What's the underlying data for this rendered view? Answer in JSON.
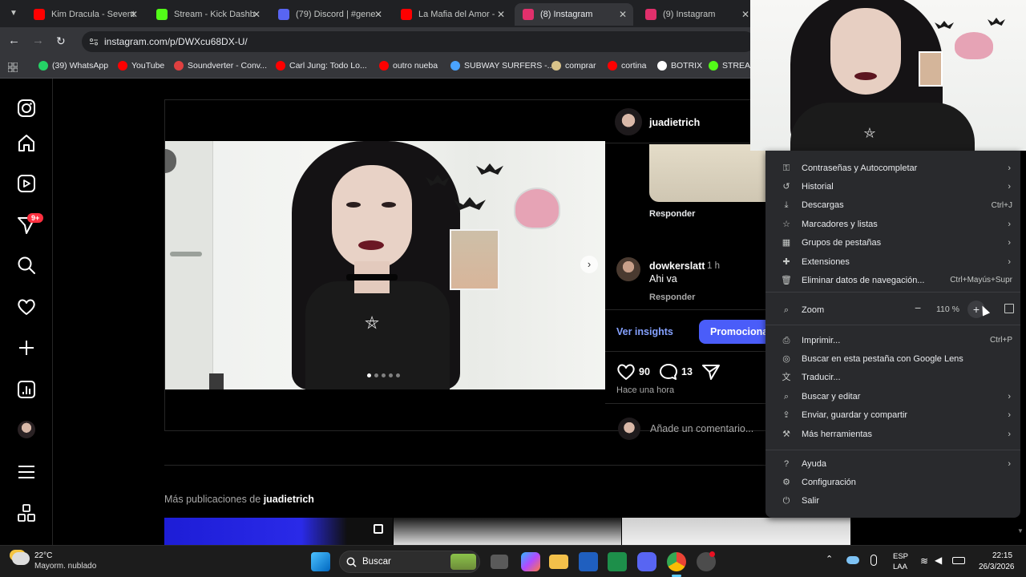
{
  "browser": {
    "tabs": [
      {
        "title": "Kim Dracula - Sevent",
        "color": "#ff0000"
      },
      {
        "title": "Stream - Kick Dashb",
        "color": "#53fc18"
      },
      {
        "title": "(79) Discord | #gene",
        "color": "#5865f2"
      },
      {
        "title": "La Mafia del Amor -",
        "color": "#ff0000"
      },
      {
        "title": "(8) Instagram",
        "color": "#e1306c"
      },
      {
        "title": "(9) Instagram",
        "color": "#e1306c"
      }
    ],
    "url": "instagram.com/p/DWXcu68DX-U/",
    "bookmarks": [
      {
        "label": "(39) WhatsApp",
        "color": "#25d366"
      },
      {
        "label": "YouTube",
        "color": "#ff0000"
      },
      {
        "label": "Soundverter - Conv...",
        "color": "#e04040"
      },
      {
        "label": "Carl Jung: Todo Lo...",
        "color": "#ff0000"
      },
      {
        "label": "outro nueba",
        "color": "#ff0000"
      },
      {
        "label": "SUBWAY SURFERS -...",
        "color": "#4aa3ff"
      },
      {
        "label": "comprar",
        "color": "#d9c38a"
      },
      {
        "label": "cortina",
        "color": "#ff0000"
      },
      {
        "label": "BOTRIX",
        "color": "#ffffff"
      },
      {
        "label": "STREAM",
        "color": "#53fc18"
      }
    ]
  },
  "instagram": {
    "notification_badge": "9+",
    "post": {
      "author": "juadietrich",
      "reply_label": "Responder",
      "comment": {
        "user": "dowkerslatt",
        "time": "1 h",
        "text": "Ahi va",
        "reply": "Responder"
      },
      "insights_label": "Ver insights",
      "promote_label": "Promociona",
      "likes": "90",
      "comments_count": "13",
      "timestamp": "Hace una hora",
      "add_comment_placeholder": "Añade un comentario...",
      "more_from_prefix": "Más publicaciones de",
      "more_from_user": "juadietrich",
      "carousel_slides": 5,
      "current_slide": 1
    }
  },
  "chrome_menu": {
    "items_top": [
      {
        "label": "Contraseñas y Autocompletar",
        "icon": "key-icon",
        "arrow": true
      },
      {
        "label": "Historial",
        "icon": "history-icon",
        "arrow": true
      },
      {
        "label": "Descargas",
        "icon": "download-icon",
        "shortcut": "Ctrl+J"
      },
      {
        "label": "Marcadores y listas",
        "icon": "star-icon",
        "arrow": true
      },
      {
        "label": "Grupos de pestañas",
        "icon": "tab-groups-icon",
        "arrow": true
      },
      {
        "label": "Extensiones",
        "icon": "extension-icon",
        "arrow": true
      },
      {
        "label": "Eliminar datos de navegación...",
        "icon": "trash-icon",
        "shortcut": "Ctrl+Mayús+Supr"
      }
    ],
    "zoom": {
      "label": "Zoom",
      "value": "110 %"
    },
    "items_mid": [
      {
        "label": "Imprimir...",
        "icon": "print-icon",
        "shortcut": "Ctrl+P"
      },
      {
        "label": "Buscar en esta pestaña con Google Lens",
        "icon": "lens-icon"
      },
      {
        "label": "Traducir...",
        "icon": "translate-icon"
      },
      {
        "label": "Buscar y editar",
        "icon": "search-edit-icon",
        "arrow": true
      },
      {
        "label": "Enviar, guardar y compartir",
        "icon": "share-icon",
        "arrow": true
      },
      {
        "label": "Más herramientas",
        "icon": "tools-icon",
        "arrow": true
      }
    ],
    "items_bottom": [
      {
        "label": "Ayuda",
        "icon": "help-icon",
        "arrow": true
      },
      {
        "label": "Configuración",
        "icon": "settings-icon"
      },
      {
        "label": "Salir",
        "icon": "exit-icon"
      }
    ]
  },
  "taskbar": {
    "weather_temp": "22°C",
    "weather_desc": "Mayorm. nublado",
    "search_label": "Buscar",
    "lang_top": "ESP",
    "lang_bottom": "LAA",
    "time": "22:15",
    "date": "26/3/2026"
  }
}
